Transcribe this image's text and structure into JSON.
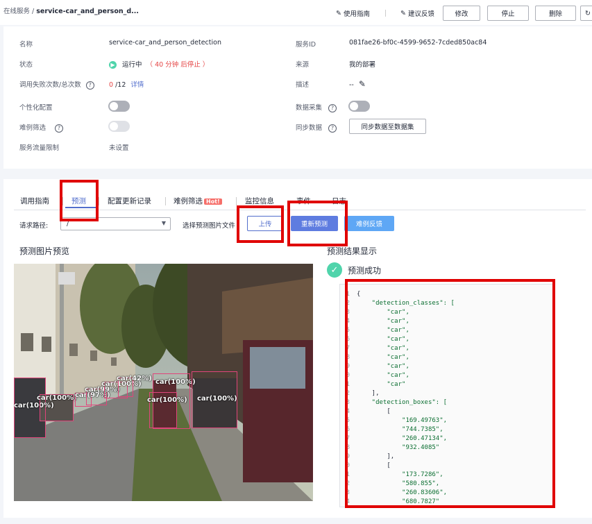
{
  "breadcrumb": {
    "parent": "在线服务",
    "separator": "/",
    "current": "service-car_and_person_d..."
  },
  "toolbar": {
    "guide": "使用指南",
    "feedback": "建议反馈",
    "modify": "修改",
    "stop": "停止",
    "delete": "删除"
  },
  "info": {
    "name_label": "名称",
    "name_value": "service-car_and_person_detection",
    "status_label": "状态",
    "status_value": "运行中",
    "status_note": "（ 40 分钟 后停止 ）",
    "calls_label": "调用失败次数/总次数",
    "calls_fail": "0",
    "calls_total": "/12",
    "calls_detail": "详情",
    "personal_label": "个性化配置",
    "hard_label": "难例筛选",
    "traffic_label": "服务流量限制",
    "traffic_value": "未设置",
    "id_label": "服务ID",
    "id_value": "081fae26-bf0c-4599-9652-7cded850ac84",
    "source_label": "来源",
    "source_value": "我的部署",
    "desc_label": "描述",
    "desc_value": "--",
    "collect_label": "数据采集",
    "sync_label": "同步数据",
    "sync_button": "同步数据至数据集"
  },
  "tabs": [
    {
      "label": "调用指南"
    },
    {
      "label": "预测"
    },
    {
      "label": "配置更新记录"
    },
    {
      "label": "难例筛选",
      "badge": "Hot!"
    },
    {
      "label": "监控信息"
    },
    {
      "label": "事件"
    },
    {
      "label": "日志"
    }
  ],
  "predict": {
    "path_label": "请求路径:",
    "path_value": "/",
    "file_label": "选择预测图片文件",
    "upload": "上传",
    "repredict": "重新预测",
    "hard_feedback": "难例反馈",
    "preview_title": "预测图片预览",
    "result_title": "预测结果显示",
    "success_text": "预测成功"
  },
  "detections": [
    "car(100%)",
    "car(100%)",
    "car(97%)",
    "car(99%)",
    "car(100%)",
    "car(42%)",
    "car(100%)",
    "car(100%)",
    "car(100%)"
  ],
  "code_lines": [
    [
      "1",
      "{"
    ],
    [
      "2",
      "    \"detection_classes\": ["
    ],
    [
      "3",
      "        \"car\","
    ],
    [
      "4",
      "        \"car\","
    ],
    [
      "5",
      "        \"car\","
    ],
    [
      "6",
      "        \"car\","
    ],
    [
      "7",
      "        \"car\","
    ],
    [
      "8",
      "        \"car\","
    ],
    [
      "9",
      "        \"car\","
    ],
    [
      "0",
      "        \"car\","
    ],
    [
      "1",
      "        \"car\""
    ],
    [
      "2",
      "    ],"
    ],
    [
      "3",
      "    \"detection_boxes\": ["
    ],
    [
      "4",
      "        ["
    ],
    [
      "5",
      "            \"169.49763\","
    ],
    [
      "6",
      "            \"744.7385\","
    ],
    [
      "7",
      "            \"260.47134\","
    ],
    [
      "8",
      "            \"932.4085\""
    ],
    [
      "9",
      "        ],"
    ],
    [
      "0",
      "        ["
    ],
    [
      "1",
      "            \"173.7286\","
    ],
    [
      "2",
      "            \"580.855\","
    ],
    [
      "3",
      "            \"260.83606\","
    ],
    [
      "4",
      "            \"680.7827\""
    ]
  ],
  "colors": {
    "accent": "#526ecc",
    "primary": "#5e7ce0",
    "success": "#50d4ab",
    "annotation": "#e00000"
  }
}
